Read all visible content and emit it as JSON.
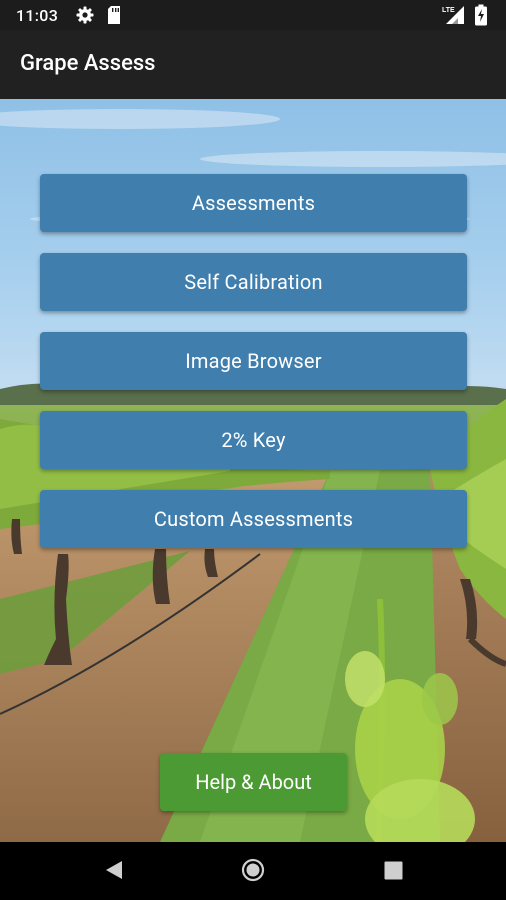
{
  "status_bar": {
    "time": "11:03",
    "network_label": "LTE",
    "icons": [
      "gear-icon",
      "sd-card-icon",
      "signal-icon",
      "battery-icon"
    ]
  },
  "app_bar": {
    "title": "Grape Assess"
  },
  "menu": {
    "buttons": [
      {
        "label": "Assessments"
      },
      {
        "label": "Self Calibration"
      },
      {
        "label": "Image Browser"
      },
      {
        "label": "2% Key"
      },
      {
        "label": "Custom Assessments"
      }
    ],
    "help_label": "Help & About"
  },
  "nav_bar": {
    "icons": [
      "back-icon",
      "home-icon",
      "recents-icon"
    ]
  },
  "colors": {
    "menu_button": "#3f7ead",
    "help_button": "#4c9a33",
    "app_bar": "#212121",
    "status_bar": "#1c1c1c"
  }
}
